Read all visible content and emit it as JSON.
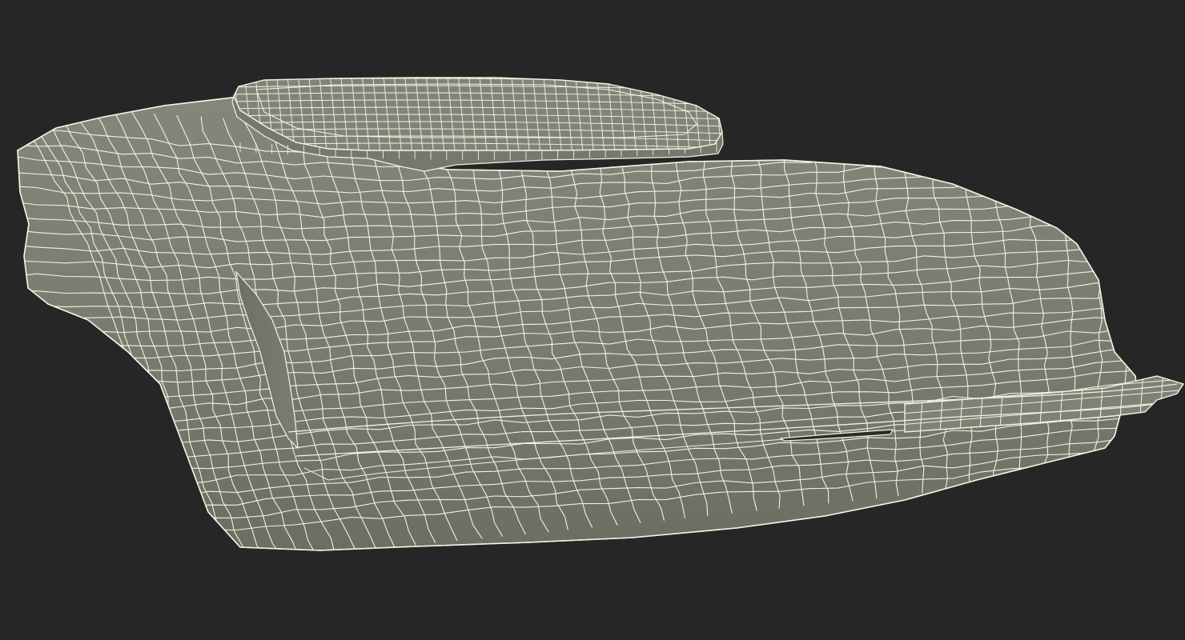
{
  "scene": {
    "subject_icon": "wireframe-bag-icon",
    "colors": {
      "background": "#262626",
      "surface": "#7a7b70",
      "surface_dark": "#6e6f65",
      "surface_light": "#8a8b80",
      "wire": "#f4f1e0"
    }
  }
}
